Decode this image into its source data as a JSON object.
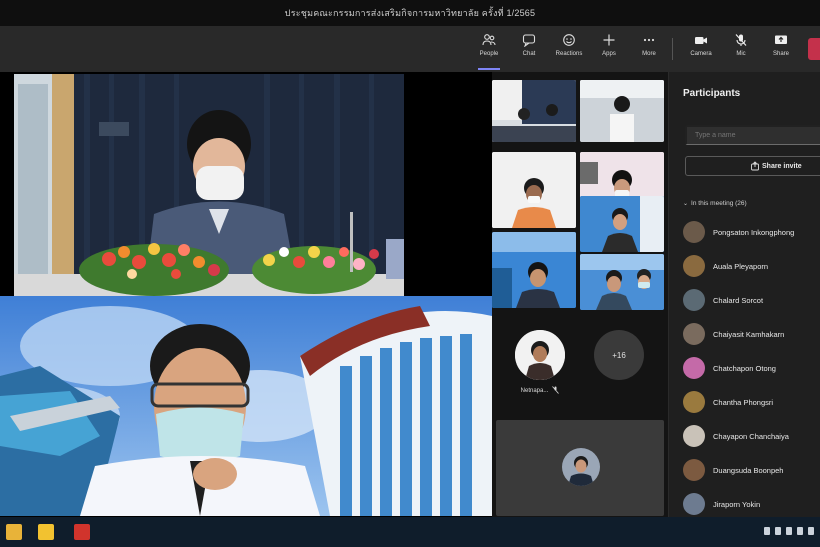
{
  "window": {
    "title": "ประชุมคณะกรรมการส่งเสริมกิจการมหาวิทยาลัย ครั้งที่ 1/2565"
  },
  "toolbar": {
    "timer": "",
    "buttons": [
      {
        "name": "people",
        "label": "People"
      },
      {
        "name": "chat",
        "label": "Chat"
      },
      {
        "name": "reactions",
        "label": "Reactions"
      },
      {
        "name": "apps",
        "label": "Apps"
      },
      {
        "name": "more",
        "label": "More"
      },
      {
        "name": "camera",
        "label": "Camera"
      },
      {
        "name": "mic",
        "label": "Mic"
      },
      {
        "name": "share",
        "label": "Share"
      }
    ]
  },
  "grid": {
    "avatar_name": "Netnapa...",
    "more_count": "+16"
  },
  "panel": {
    "title": "Participants",
    "search_placeholder": "Type a name",
    "share_invite": "Share invite",
    "section": "In this meeting (26)",
    "participants": [
      {
        "name": "Pongsaton Inkongphong",
        "color": "#6b5a4a"
      },
      {
        "name": "Auala Pleyaporn",
        "color": "#8a6a3f"
      },
      {
        "name": "Chalard Sorcot",
        "color": "#5b6a74"
      },
      {
        "name": "Chaiyasit Kamhakarn",
        "color": "#7a6b5e"
      },
      {
        "name": "Chatchapon Otong",
        "color": "#c46aa8"
      },
      {
        "name": "Chantha Phongsri",
        "color": "#9a7a3e"
      },
      {
        "name": "Chayapon Chanchaiya",
        "color": "#c9c2b8"
      },
      {
        "name": "Duangsuda Boonpeh",
        "color": "#7c5a40"
      },
      {
        "name": "Jiraporn Yokin",
        "color": "#6d7b90"
      }
    ]
  },
  "colors": {
    "accent": "#7f85f5",
    "leave": "#c4314b"
  }
}
